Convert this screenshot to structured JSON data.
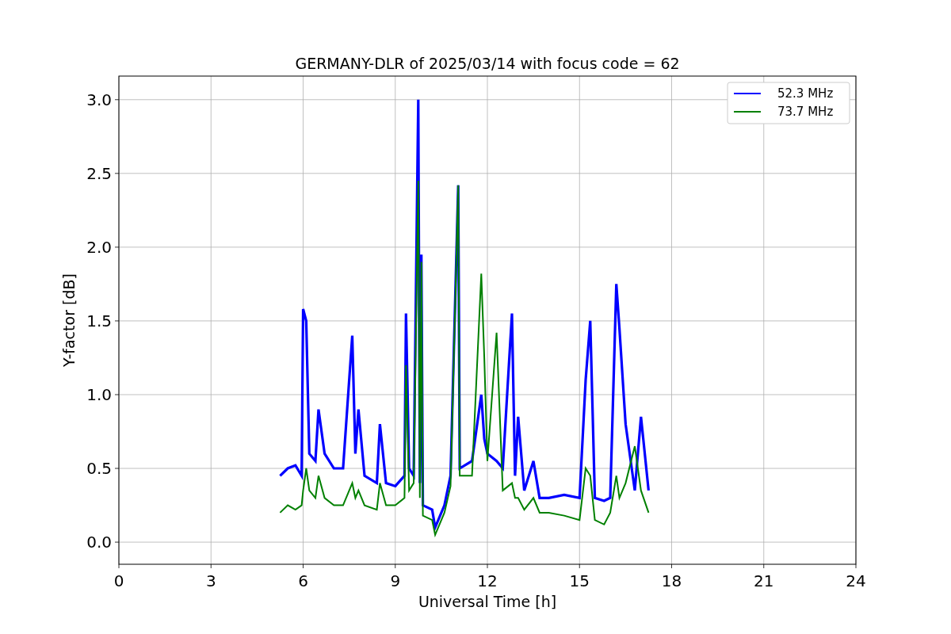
{
  "chart_data": {
    "type": "line",
    "title": "GERMANY-DLR of 2025/03/14 with focus code = 62",
    "xlabel": "Universal Time [h]",
    "ylabel": "Y-factor [dB]",
    "x": [
      5.25,
      5.5,
      5.75,
      5.95,
      6.0,
      6.1,
      6.2,
      6.4,
      6.5,
      6.7,
      7.0,
      7.3,
      7.6,
      7.7,
      7.8,
      8.0,
      8.4,
      8.5,
      8.7,
      9.0,
      9.3,
      9.35,
      9.45,
      9.6,
      9.75,
      9.8,
      9.85,
      9.9,
      10.2,
      10.3,
      10.6,
      10.8,
      11.05,
      11.1,
      11.5,
      11.8,
      11.9,
      12.0,
      12.3,
      12.5,
      12.8,
      12.9,
      13.0,
      13.2,
      13.5,
      13.7,
      14.0,
      14.5,
      15.0,
      15.2,
      15.35,
      15.5,
      15.8,
      16.0,
      16.2,
      16.3,
      16.5,
      16.8,
      17.0,
      17.25
    ],
    "series": [
      {
        "name": "52.3 MHz",
        "color": "#0000ff",
        "values": [
          0.45,
          0.5,
          0.52,
          0.45,
          1.58,
          1.5,
          0.6,
          0.55,
          0.9,
          0.6,
          0.5,
          0.5,
          1.4,
          0.6,
          0.9,
          0.45,
          0.4,
          0.8,
          0.4,
          0.38,
          0.45,
          1.55,
          0.5,
          0.45,
          3.0,
          0.4,
          1.95,
          0.25,
          0.22,
          0.1,
          0.25,
          0.45,
          2.42,
          0.5,
          0.55,
          1.0,
          0.7,
          0.6,
          0.55,
          0.5,
          1.55,
          0.45,
          0.85,
          0.35,
          0.55,
          0.3,
          0.3,
          0.32,
          0.3,
          1.1,
          1.5,
          0.3,
          0.28,
          0.3,
          1.75,
          1.45,
          0.8,
          0.35,
          0.85,
          0.35
        ]
      },
      {
        "name": "73.7 MHz",
        "color": "#008000",
        "values": [
          0.2,
          0.25,
          0.22,
          0.25,
          0.35,
          0.5,
          0.35,
          0.3,
          0.45,
          0.3,
          0.25,
          0.25,
          0.4,
          0.3,
          0.35,
          0.25,
          0.22,
          0.4,
          0.25,
          0.25,
          0.3,
          1.2,
          0.35,
          0.4,
          2.45,
          0.3,
          1.9,
          0.18,
          0.15,
          0.05,
          0.2,
          0.38,
          2.42,
          0.45,
          0.45,
          1.82,
          1.25,
          0.55,
          1.42,
          0.35,
          0.4,
          0.3,
          0.3,
          0.22,
          0.3,
          0.2,
          0.2,
          0.18,
          0.15,
          0.5,
          0.45,
          0.15,
          0.12,
          0.2,
          0.45,
          0.3,
          0.4,
          0.65,
          0.35,
          0.2
        ]
      }
    ],
    "grid": true,
    "legend": true,
    "xlim": [
      0,
      24
    ],
    "ylim": [
      -0.15,
      3.16
    ],
    "xticks": [
      0,
      3,
      6,
      9,
      12,
      15,
      18,
      21,
      24
    ],
    "yticks": [
      {
        "value": 0,
        "label": "0.0"
      },
      {
        "value": 0.5,
        "label": "0.5"
      },
      {
        "value": 1,
        "label": "1.0"
      },
      {
        "value": 1.5,
        "label": "1.5"
      },
      {
        "value": 2,
        "label": "2.0"
      },
      {
        "value": 2.5,
        "label": "2.5"
      },
      {
        "value": 3,
        "label": "3.0"
      }
    ]
  }
}
